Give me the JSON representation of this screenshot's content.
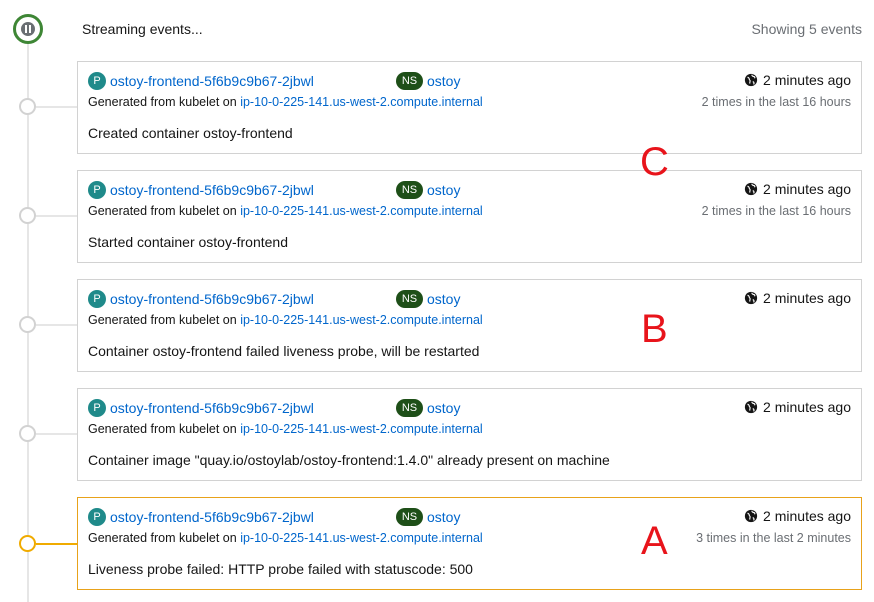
{
  "header": {
    "status": "Streaming events...",
    "count": "Showing 5 events"
  },
  "colors": {
    "pod_badge": "#1f8a8a",
    "ns_badge": "#1e4f18",
    "link": "#0066cc",
    "warning": "#e8a21a",
    "annotation": "#e8141b"
  },
  "events": [
    {
      "pod_badge": "P",
      "pod": "ostoy-frontend-5f6b9c9b67-2jbwl",
      "ns_badge": "NS",
      "namespace": "ostoy",
      "generated_prefix": "Generated from kubelet on",
      "node": "ip-10-0-225-141.us-west-2.compute.internal",
      "time": "2 minutes ago",
      "count": "2 times in the last 16 hours",
      "message": "Created container ostoy-frontend"
    },
    {
      "pod_badge": "P",
      "pod": "ostoy-frontend-5f6b9c9b67-2jbwl",
      "ns_badge": "NS",
      "namespace": "ostoy",
      "generated_prefix": "Generated from kubelet on",
      "node": "ip-10-0-225-141.us-west-2.compute.internal",
      "time": "2 minutes ago",
      "count": "2 times in the last 16 hours",
      "message": "Started container ostoy-frontend"
    },
    {
      "pod_badge": "P",
      "pod": "ostoy-frontend-5f6b9c9b67-2jbwl",
      "ns_badge": "NS",
      "namespace": "ostoy",
      "generated_prefix": "Generated from kubelet on",
      "node": "ip-10-0-225-141.us-west-2.compute.internal",
      "time": "2 minutes ago",
      "count": "",
      "message": "Container ostoy-frontend failed liveness probe, will be restarted"
    },
    {
      "pod_badge": "P",
      "pod": "ostoy-frontend-5f6b9c9b67-2jbwl",
      "ns_badge": "NS",
      "namespace": "ostoy",
      "generated_prefix": "Generated from kubelet on",
      "node": "ip-10-0-225-141.us-west-2.compute.internal",
      "time": "2 minutes ago",
      "count": "",
      "message": "Container image \"quay.io/ostoylab/ostoy-frontend:1.4.0\" already present on machine"
    },
    {
      "pod_badge": "P",
      "pod": "ostoy-frontend-5f6b9c9b67-2jbwl",
      "ns_badge": "NS",
      "namespace": "ostoy",
      "generated_prefix": "Generated from kubelet on",
      "node": "ip-10-0-225-141.us-west-2.compute.internal",
      "time": "2 minutes ago",
      "count": "3 times in the last 2 minutes",
      "message": "Liveness probe failed: HTTP probe failed with statuscode: 500"
    }
  ],
  "annotations": {
    "c": "C",
    "b": "B",
    "a": "A"
  }
}
